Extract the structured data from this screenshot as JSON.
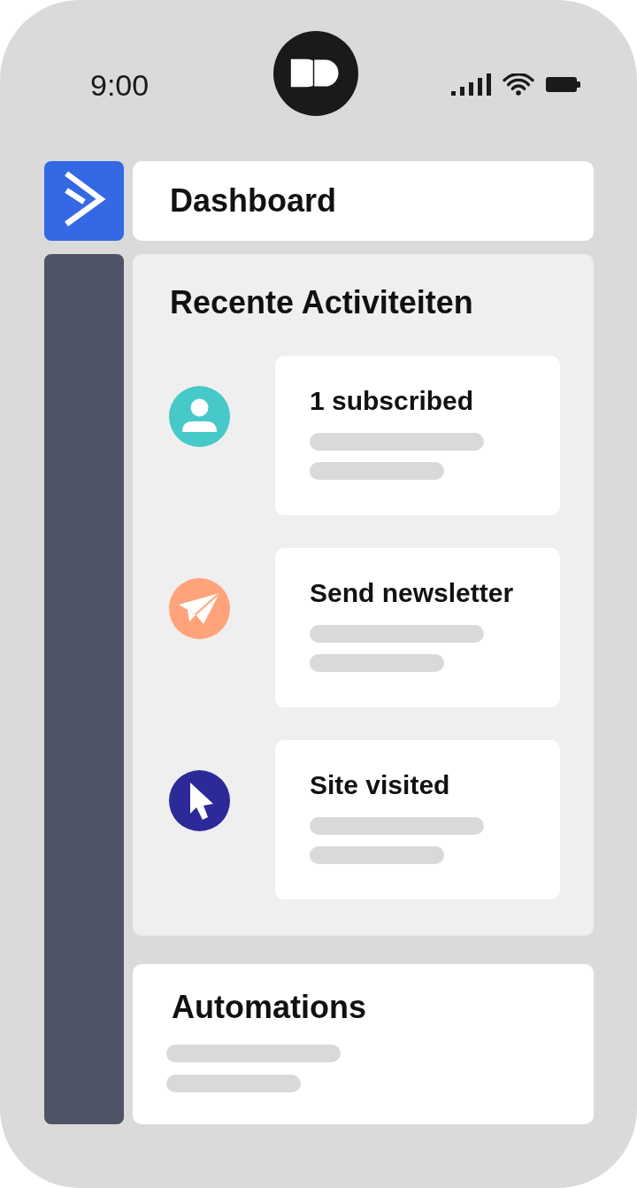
{
  "status_bar": {
    "time": "9:00"
  },
  "header": {
    "title": "Dashboard"
  },
  "recent_activity": {
    "title": "Recente Activiteiten",
    "items": [
      {
        "kind": "subscriber",
        "title": "1 subscribed",
        "color": "#46c9c8"
      },
      {
        "kind": "newsletter",
        "title": "Send newsletter",
        "color": "#ffa47a"
      },
      {
        "kind": "visit",
        "title": "Site visited",
        "color": "#2c2a98"
      }
    ]
  },
  "automations": {
    "title": "Automations"
  }
}
